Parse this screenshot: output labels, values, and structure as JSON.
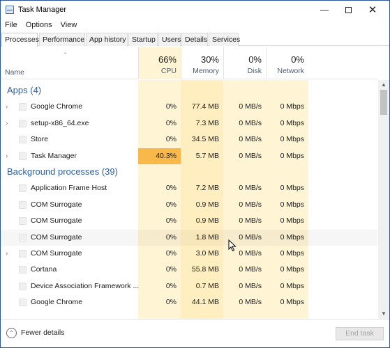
{
  "window": {
    "title": "Task Manager"
  },
  "menu": [
    "File",
    "Options",
    "View"
  ],
  "tabs": [
    "Processes",
    "Performance",
    "App history",
    "Startup",
    "Users",
    "Details",
    "Services"
  ],
  "header": {
    "name_label": "Name",
    "cpu": {
      "pct": "66%",
      "label": "CPU"
    },
    "memory": {
      "pct": "30%",
      "label": "Memory"
    },
    "disk": {
      "pct": "0%",
      "label": "Disk"
    },
    "network": {
      "pct": "0%",
      "label": "Network"
    }
  },
  "rows": [
    {
      "type": "group",
      "label": "Apps (4)"
    },
    {
      "type": "process",
      "name": "Google Chrome",
      "cpu": "0%",
      "memory": "77.4 MB",
      "disk": "0 MB/s",
      "network": "0 Mbps",
      "expandable": true
    },
    {
      "type": "process",
      "name": "setup-x86_64.exe",
      "cpu": "0%",
      "memory": "7.3 MB",
      "disk": "0 MB/s",
      "network": "0 Mbps",
      "expandable": true
    },
    {
      "type": "process",
      "name": "Store",
      "cpu": "0%",
      "memory": "34.5 MB",
      "disk": "0 MB/s",
      "network": "0 Mbps",
      "expandable": false
    },
    {
      "type": "process",
      "name": "Task Manager",
      "cpu": "40.3%",
      "memory": "5.7 MB",
      "disk": "0 MB/s",
      "network": "0 Mbps",
      "expandable": true,
      "cpu_hot": true
    },
    {
      "type": "group",
      "label": "Background processes (39)"
    },
    {
      "type": "process",
      "name": "Application Frame Host",
      "cpu": "0%",
      "memory": "7.2 MB",
      "disk": "0 MB/s",
      "network": "0 Mbps",
      "expandable": false
    },
    {
      "type": "process",
      "name": "COM Surrogate",
      "cpu": "0%",
      "memory": "0.9 MB",
      "disk": "0 MB/s",
      "network": "0 Mbps",
      "expandable": false
    },
    {
      "type": "process",
      "name": "COM Surrogate",
      "cpu": "0%",
      "memory": "0.9 MB",
      "disk": "0 MB/s",
      "network": "0 Mbps",
      "expandable": false
    },
    {
      "type": "process",
      "name": "COM Surrogate",
      "cpu": "0%",
      "memory": "1.8 MB",
      "disk": "0 MB/s",
      "network": "0 Mbps",
      "expandable": false,
      "hovered": true
    },
    {
      "type": "process",
      "name": "COM Surrogate",
      "cpu": "0%",
      "memory": "3.0 MB",
      "disk": "0 MB/s",
      "network": "0 Mbps",
      "expandable": true
    },
    {
      "type": "process",
      "name": "Cortana",
      "cpu": "0%",
      "memory": "55.8 MB",
      "disk": "0 MB/s",
      "network": "0 Mbps",
      "expandable": false
    },
    {
      "type": "process",
      "name": "Device Association Framework ...",
      "cpu": "0%",
      "memory": "0.7 MB",
      "disk": "0 MB/s",
      "network": "0 Mbps",
      "expandable": false
    },
    {
      "type": "process",
      "name": "Google Chrome",
      "cpu": "0%",
      "memory": "44.1 MB",
      "disk": "0 MB/s",
      "network": "0 Mbps",
      "expandable": false
    }
  ],
  "footer": {
    "fewer_details": "Fewer details",
    "end_task": "End task"
  },
  "colors": {
    "accent": "#2b5fa6",
    "cpu_bg": "#fff4d4",
    "memory_bg": "#ffefc0",
    "disk_bg": "#fff4d4",
    "network_bg": "#fff4d4",
    "cpu_hot": "#f9b84a"
  }
}
